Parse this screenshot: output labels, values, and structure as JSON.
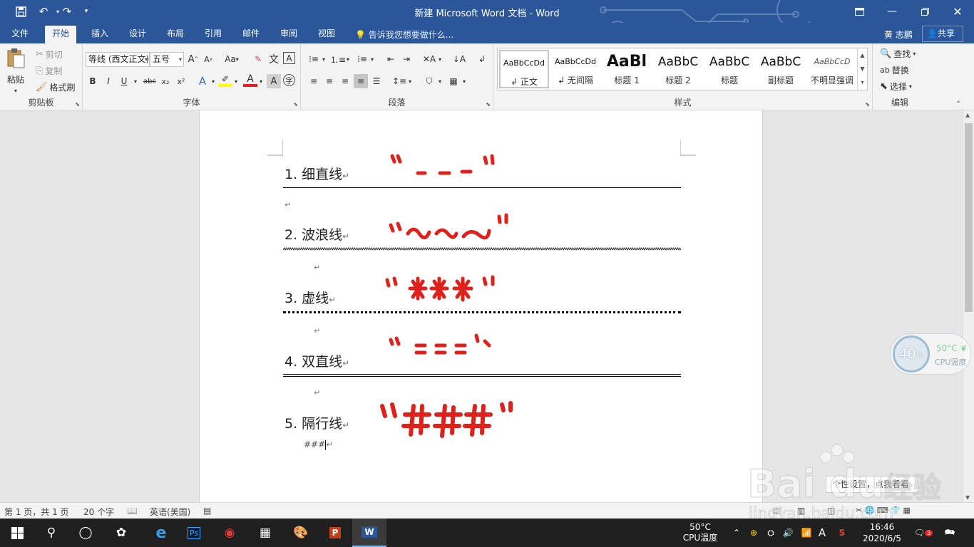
{
  "titlebar": {
    "title": "新建 Microsoft Word 文档 - Word",
    "save_icon": "save-icon",
    "undo_icon": "undo-icon",
    "redo_icon": "redo-icon"
  },
  "tabs": [
    "文件",
    "开始",
    "插入",
    "设计",
    "布局",
    "引用",
    "邮件",
    "审阅",
    "视图"
  ],
  "active_tab": "开始",
  "tellme": "告诉我您想要做什么...",
  "user": "黄 志鹏",
  "share": "共享",
  "clipboard": {
    "paste": "粘贴",
    "cut": "剪切",
    "copy": "复制",
    "format_painter": "格式刷",
    "label": "剪贴板"
  },
  "font": {
    "font_name": "等线 (西文正文)",
    "font_size": "五号",
    "label": "字体",
    "bold": "B",
    "italic": "I",
    "underline": "U",
    "strike": "abc",
    "subscript": "x₂",
    "superscript": "x²",
    "case": "Aa",
    "grow": "A",
    "shrink": "A"
  },
  "paragraph": {
    "label": "段落"
  },
  "styles": {
    "label": "样式",
    "items": [
      {
        "sample": "AaBbCcDd",
        "name": "↲ 正文"
      },
      {
        "sample": "AaBbCcDd",
        "name": "↲ 无间隔"
      },
      {
        "sample": "AaBl",
        "name": "标题 1"
      },
      {
        "sample": "AaBbC",
        "name": "标题 2"
      },
      {
        "sample": "AaBbC",
        "name": "标题"
      },
      {
        "sample": "AaBbC",
        "name": "副标题"
      },
      {
        "sample": "AaBbCcD",
        "name": "不明显强调"
      }
    ]
  },
  "editing": {
    "find": "查找",
    "replace": "替换",
    "select": "选择",
    "label": "编辑"
  },
  "document": {
    "headings": [
      {
        "text": "1. 细直线"
      },
      {
        "text": "2. 波浪线"
      },
      {
        "text": "3. 虚线"
      },
      {
        "text": "4. 双直线"
      },
      {
        "text": "5. 隔行线"
      }
    ],
    "return_mark": "↵",
    "typed_text": "###"
  },
  "cpu_widget": {
    "percent": "40",
    "percent_sign": "%",
    "temp": "50°C",
    "label": "CPU温度"
  },
  "statusbar": {
    "page": "第 1 页，共 1 页",
    "words": "20 个字",
    "language": "英语(美国)",
    "tooltip": "个性设置，点我看看"
  },
  "taskbar": {
    "cpu_temp": "50°C",
    "cpu_label": "CPU温度",
    "time": "16:46",
    "date": "2020/6/5",
    "ime": "A",
    "notifications": "3"
  },
  "watermark": {
    "brand": "Bai du 经验",
    "url": "jingyan.baidu.com"
  },
  "colors": {
    "word_blue": "#2b579a",
    "annotation_red": "#e0201b"
  }
}
